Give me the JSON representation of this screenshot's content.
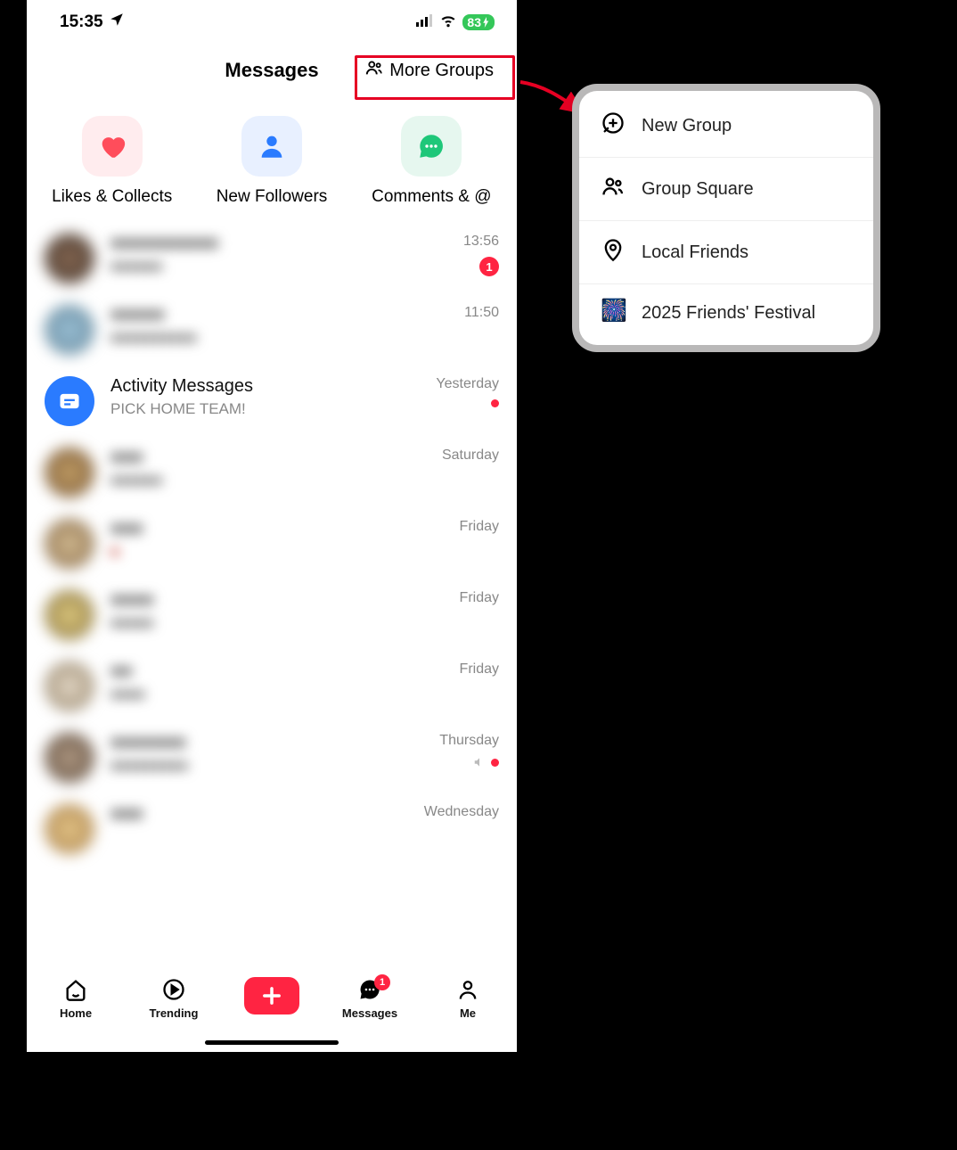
{
  "status": {
    "time": "15:35",
    "battery": "83"
  },
  "header": {
    "title": "Messages",
    "more_groups": "More Groups"
  },
  "notif": {
    "likes": "Likes & Collects",
    "followers": "New Followers",
    "comments": "Comments & @"
  },
  "rows": [
    {
      "time": "13:56",
      "badge": "1"
    },
    {
      "time": "11:50"
    },
    {
      "title": "Activity Messages",
      "sub": "PICK HOME TEAM!",
      "time": "Yesterday",
      "dot": true,
      "system": true
    },
    {
      "time": "Saturday"
    },
    {
      "time": "Friday"
    },
    {
      "time": "Friday"
    },
    {
      "time": "Friday"
    },
    {
      "time": "Thursday",
      "muted_dot": true
    },
    {
      "time": "Wednesday"
    }
  ],
  "tabs": {
    "home": "Home",
    "trending": "Trending",
    "messages": "Messages",
    "messages_badge": "1",
    "me": "Me"
  },
  "popover": {
    "items": [
      "New Group",
      "Group Square",
      "Local Friends",
      "2025 Friends' Festival"
    ]
  },
  "colors": {
    "accent": "#ff2442",
    "green": "#34c759",
    "blue": "#2a7bff"
  }
}
